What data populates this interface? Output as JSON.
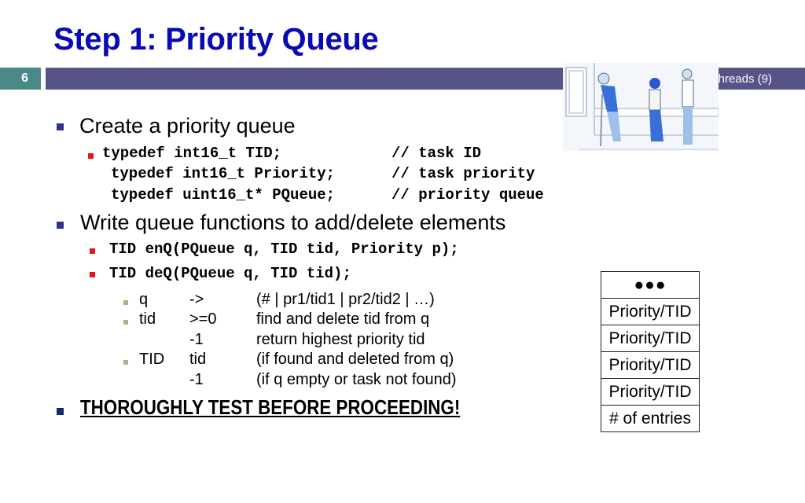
{
  "slide": {
    "title": "Step 1: Priority Queue",
    "number": "6",
    "header_label": "hreads (9)",
    "illustration": "patients-queue-illustration"
  },
  "content": {
    "bullet1": "Create a priority queue",
    "typedefs": [
      {
        "code": "typedef int16_t TID;",
        "comment": "// task ID"
      },
      {
        "code": "typedef int16_t Priority;",
        "comment": "// task priority"
      },
      {
        "code": "typedef uint16_t* PQueue;",
        "comment": "// priority queue"
      }
    ],
    "bullet2": "Write queue functions to add/delete elements",
    "functions": [
      "TID enQ(PQueue q, TID tid, Priority p);",
      "TID deQ(PQueue q, TID tid);"
    ],
    "params": [
      {
        "name": "q",
        "value": "->",
        "desc": "(# | pr1/tid1 | pr2/tid2 | …)"
      },
      {
        "name": "tid",
        "value": ">=0",
        "desc": "find and delete tid from q"
      },
      {
        "name": "",
        "value": "-1",
        "desc": "return highest priority tid"
      },
      {
        "name": "TID",
        "value": "tid",
        "desc": "(if found and deleted from q)"
      },
      {
        "name": "",
        "value": "-1",
        "desc": "(if q empty or task not found)"
      }
    ],
    "bullet3": "THOROUGHLY TEST BEFORE PROCEEDING!"
  },
  "queue_diagram": {
    "cells": [
      "●●●",
      "Priority/TID",
      "Priority/TID",
      "Priority/TID",
      "Priority/TID",
      "# of entries"
    ]
  }
}
